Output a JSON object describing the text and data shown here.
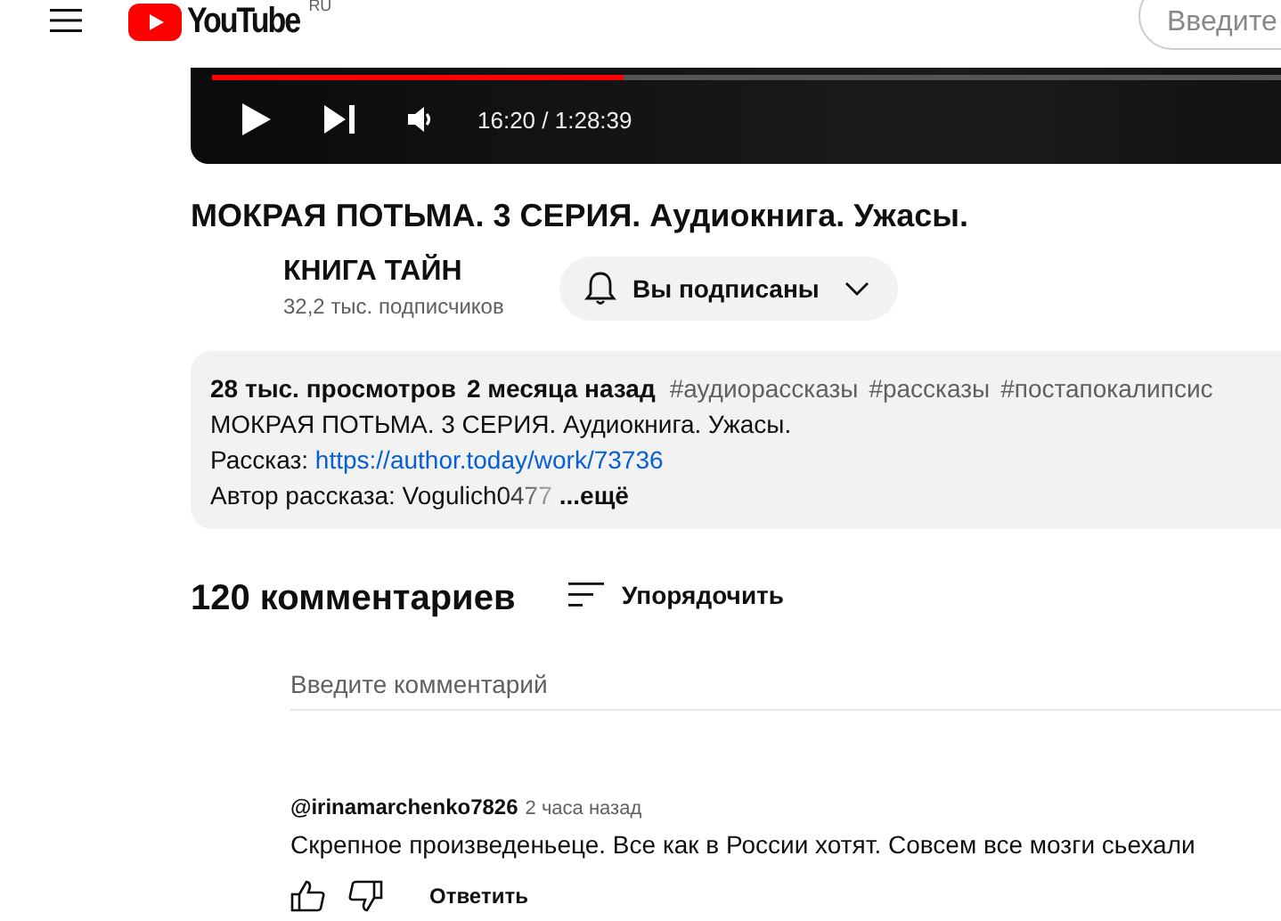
{
  "header": {
    "logo_text": "YouTube",
    "region": "RU",
    "search": {
      "placeholder": "Введите"
    }
  },
  "player": {
    "level": 0.385,
    "playing": false,
    "time": "16:20 / 1:28:39"
  },
  "video": {
    "title": "МОКРАЯ ПОТЬМА. 3 СЕРИЯ. Аудиокнига. Ужасы."
  },
  "channel": {
    "name": "КНИГА ТАЙН",
    "subscribers": "32,2 тыс. подписчиков",
    "subscribe_button": {
      "label": "Вы подписаны",
      "subscribed": true
    }
  },
  "description": {
    "views": "28 тыс. просмотров",
    "date": "2 месяца назад",
    "hashtags": [
      "#аудиорассказы",
      "#рассказы",
      "#постапокалипсис"
    ],
    "lines": [
      {
        "kind": "text",
        "text": "МОКРАЯ ПОТЬМА. 3 СЕРИЯ. Аудиокнига. Ужасы."
      },
      {
        "kind": "link",
        "text": "Рассказ: ",
        "link": "https://author.today/work/73736"
      },
      {
        "kind": "more",
        "text": "Автор рассказа: Vogulich0477",
        "more": "...ещё"
      }
    ]
  },
  "comments": {
    "count": "120 комментариев",
    "sort_label": "Упорядочить",
    "input": {
      "placeholder": "Введите комментарий"
    },
    "items": [
      {
        "author": "@irinamarchenko7826",
        "time": "2 часа назад",
        "text": "Скрепное произведеньеце. Все как в России хотят. Совсем все мозги сьехали",
        "reply": "Ответить"
      }
    ]
  }
}
